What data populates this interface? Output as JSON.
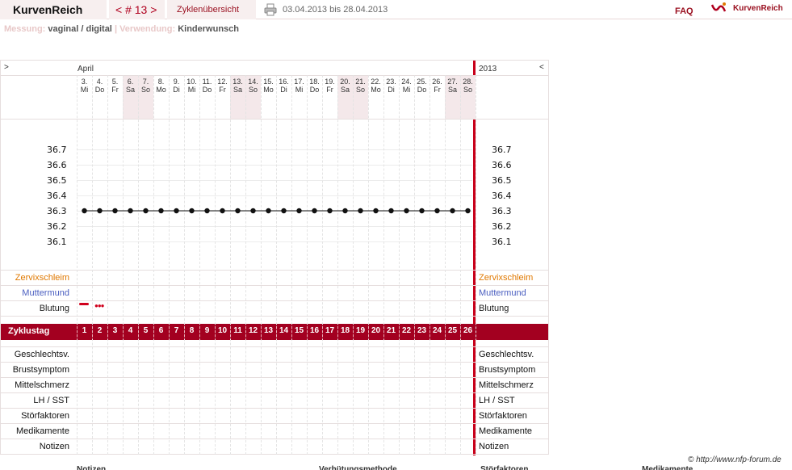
{
  "header": {
    "brand": "KurvenReich",
    "cycle_nav": "< # 13 >",
    "overview_tab": "Zyklenübersicht",
    "date_range": "03.04.2013 bis 28.04.2013",
    "faq": "FAQ",
    "logo_text": "KurvenReich",
    "print_icon": "printer-icon",
    "logo_icon": "kurvenreich-logo-icon"
  },
  "meta": {
    "messung_label": "Messung:",
    "messung_value": "vaginal / digital",
    "separator": "|",
    "verwendung_label": "Verwendung:",
    "verwendung_value": "Kinderwunsch"
  },
  "chart": {
    "nav_left": ">",
    "nav_right": "<",
    "month": "April",
    "year": "2013",
    "days": [
      {
        "num": "3.",
        "name": "Mi",
        "weekend": false
      },
      {
        "num": "4.",
        "name": "Do",
        "weekend": false
      },
      {
        "num": "5.",
        "name": "Fr",
        "weekend": false
      },
      {
        "num": "6.",
        "name": "Sa",
        "weekend": true
      },
      {
        "num": "7.",
        "name": "So",
        "weekend": true
      },
      {
        "num": "8.",
        "name": "Mo",
        "weekend": false
      },
      {
        "num": "9.",
        "name": "Di",
        "weekend": false
      },
      {
        "num": "10.",
        "name": "Mi",
        "weekend": false
      },
      {
        "num": "11.",
        "name": "Do",
        "weekend": false
      },
      {
        "num": "12.",
        "name": "Fr",
        "weekend": false
      },
      {
        "num": "13.",
        "name": "Sa",
        "weekend": true
      },
      {
        "num": "14.",
        "name": "So",
        "weekend": true
      },
      {
        "num": "15.",
        "name": "Mo",
        "weekend": false
      },
      {
        "num": "16.",
        "name": "Di",
        "weekend": false
      },
      {
        "num": "17.",
        "name": "Mi",
        "weekend": false
      },
      {
        "num": "18.",
        "name": "Do",
        "weekend": false
      },
      {
        "num": "19.",
        "name": "Fr",
        "weekend": false
      },
      {
        "num": "20.",
        "name": "Sa",
        "weekend": true
      },
      {
        "num": "21.",
        "name": "So",
        "weekend": true
      },
      {
        "num": "22.",
        "name": "Mo",
        "weekend": false
      },
      {
        "num": "23.",
        "name": "Di",
        "weekend": false
      },
      {
        "num": "24.",
        "name": "Mi",
        "weekend": false
      },
      {
        "num": "25.",
        "name": "Do",
        "weekend": false
      },
      {
        "num": "26.",
        "name": "Fr",
        "weekend": false
      },
      {
        "num": "27.",
        "name": "Sa",
        "weekend": true
      },
      {
        "num": "28.",
        "name": "So",
        "weekend": true
      }
    ],
    "temp_ticks": [
      "36.7",
      "36.6",
      "36.5",
      "36.4",
      "36.3",
      "36.2",
      "36.1"
    ],
    "temperatures": [
      36.3,
      36.3,
      36.3,
      36.3,
      36.3,
      36.3,
      36.3,
      36.3,
      36.3,
      36.3,
      36.3,
      36.3,
      36.3,
      36.3,
      36.3,
      36.3,
      36.3,
      36.3,
      36.3,
      36.3,
      36.3,
      36.3,
      36.3,
      36.3,
      36.3,
      36.3
    ],
    "rows_top": [
      {
        "label": "Zervixschleim",
        "color": "#e07800"
      },
      {
        "label": "Muttermund",
        "color": "#4a5ec0"
      },
      {
        "label": "Blutung",
        "color": "#222222"
      }
    ],
    "bleeding": {
      "day1": "heavy",
      "day2": "light"
    },
    "zyklustag_label": "Zyklustag",
    "rows_bottom": [
      "Geschlechtsv.",
      "Brustsymptom",
      "Mittelschmerz",
      "LH / SST",
      "Störfaktoren",
      "Medikamente",
      "Notizen"
    ],
    "accent": "#a30020"
  },
  "footer": {
    "copyright": "© http://www.nfp-forum.de",
    "labels": [
      "Notizen",
      "Verhütungsmethode",
      "Störfaktoren",
      "Medikamente"
    ]
  }
}
